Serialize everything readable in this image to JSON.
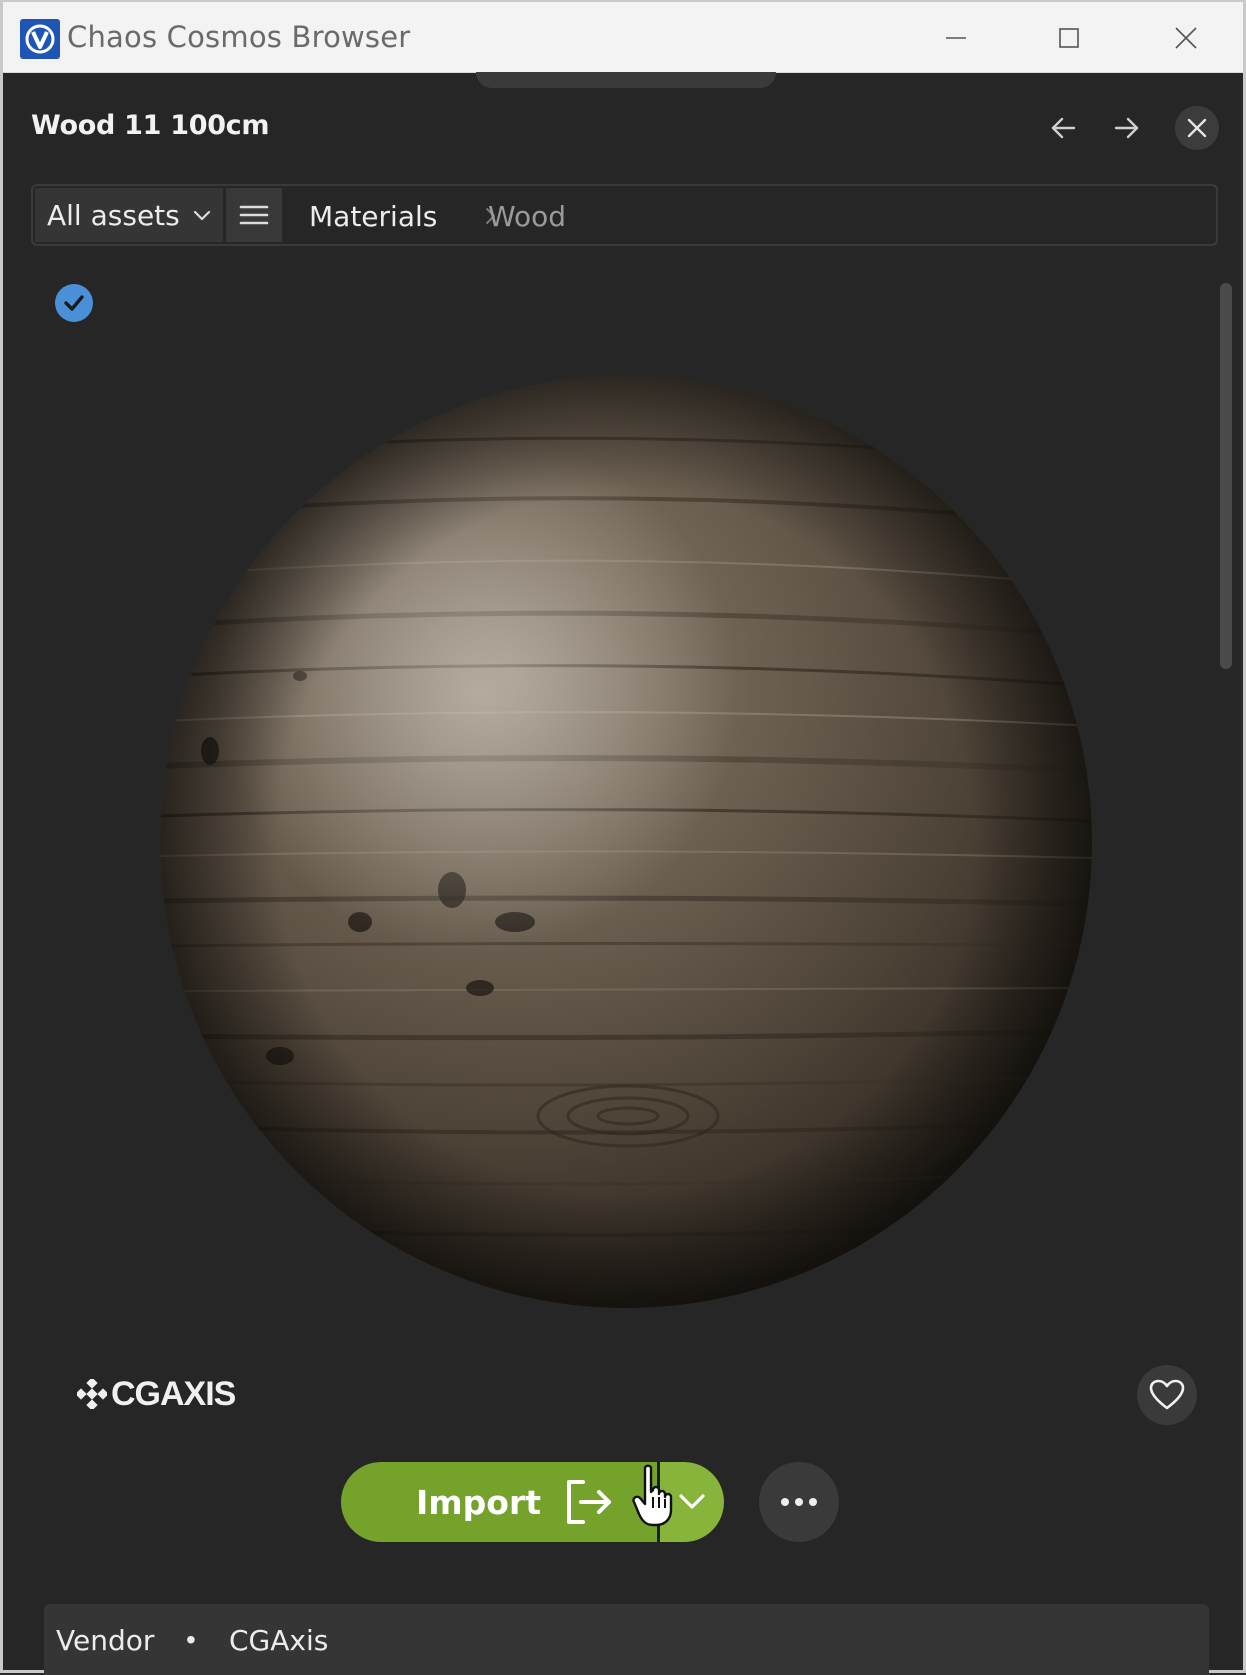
{
  "window": {
    "title": "Chaos Cosmos Browser",
    "app_icon": "chaos-v-logo"
  },
  "header": {
    "asset_title": "Wood 11 100cm"
  },
  "breadcrumb_bar": {
    "filter_label": "All assets",
    "crumbs": [
      "Materials",
      "Wood"
    ]
  },
  "preview": {
    "selected": true
  },
  "vendor": {
    "logo_text": "CGAXIS"
  },
  "actions": {
    "import_label": "Import"
  },
  "info": {
    "key": "Vendor",
    "separator": "•",
    "value": "CGAxis"
  },
  "colors": {
    "background": "#262626",
    "import_green": "#75a22b",
    "import_dropdown_green": "#87b43a",
    "check_blue": "#4a90d9",
    "titlebar": "#f3f3f3"
  }
}
